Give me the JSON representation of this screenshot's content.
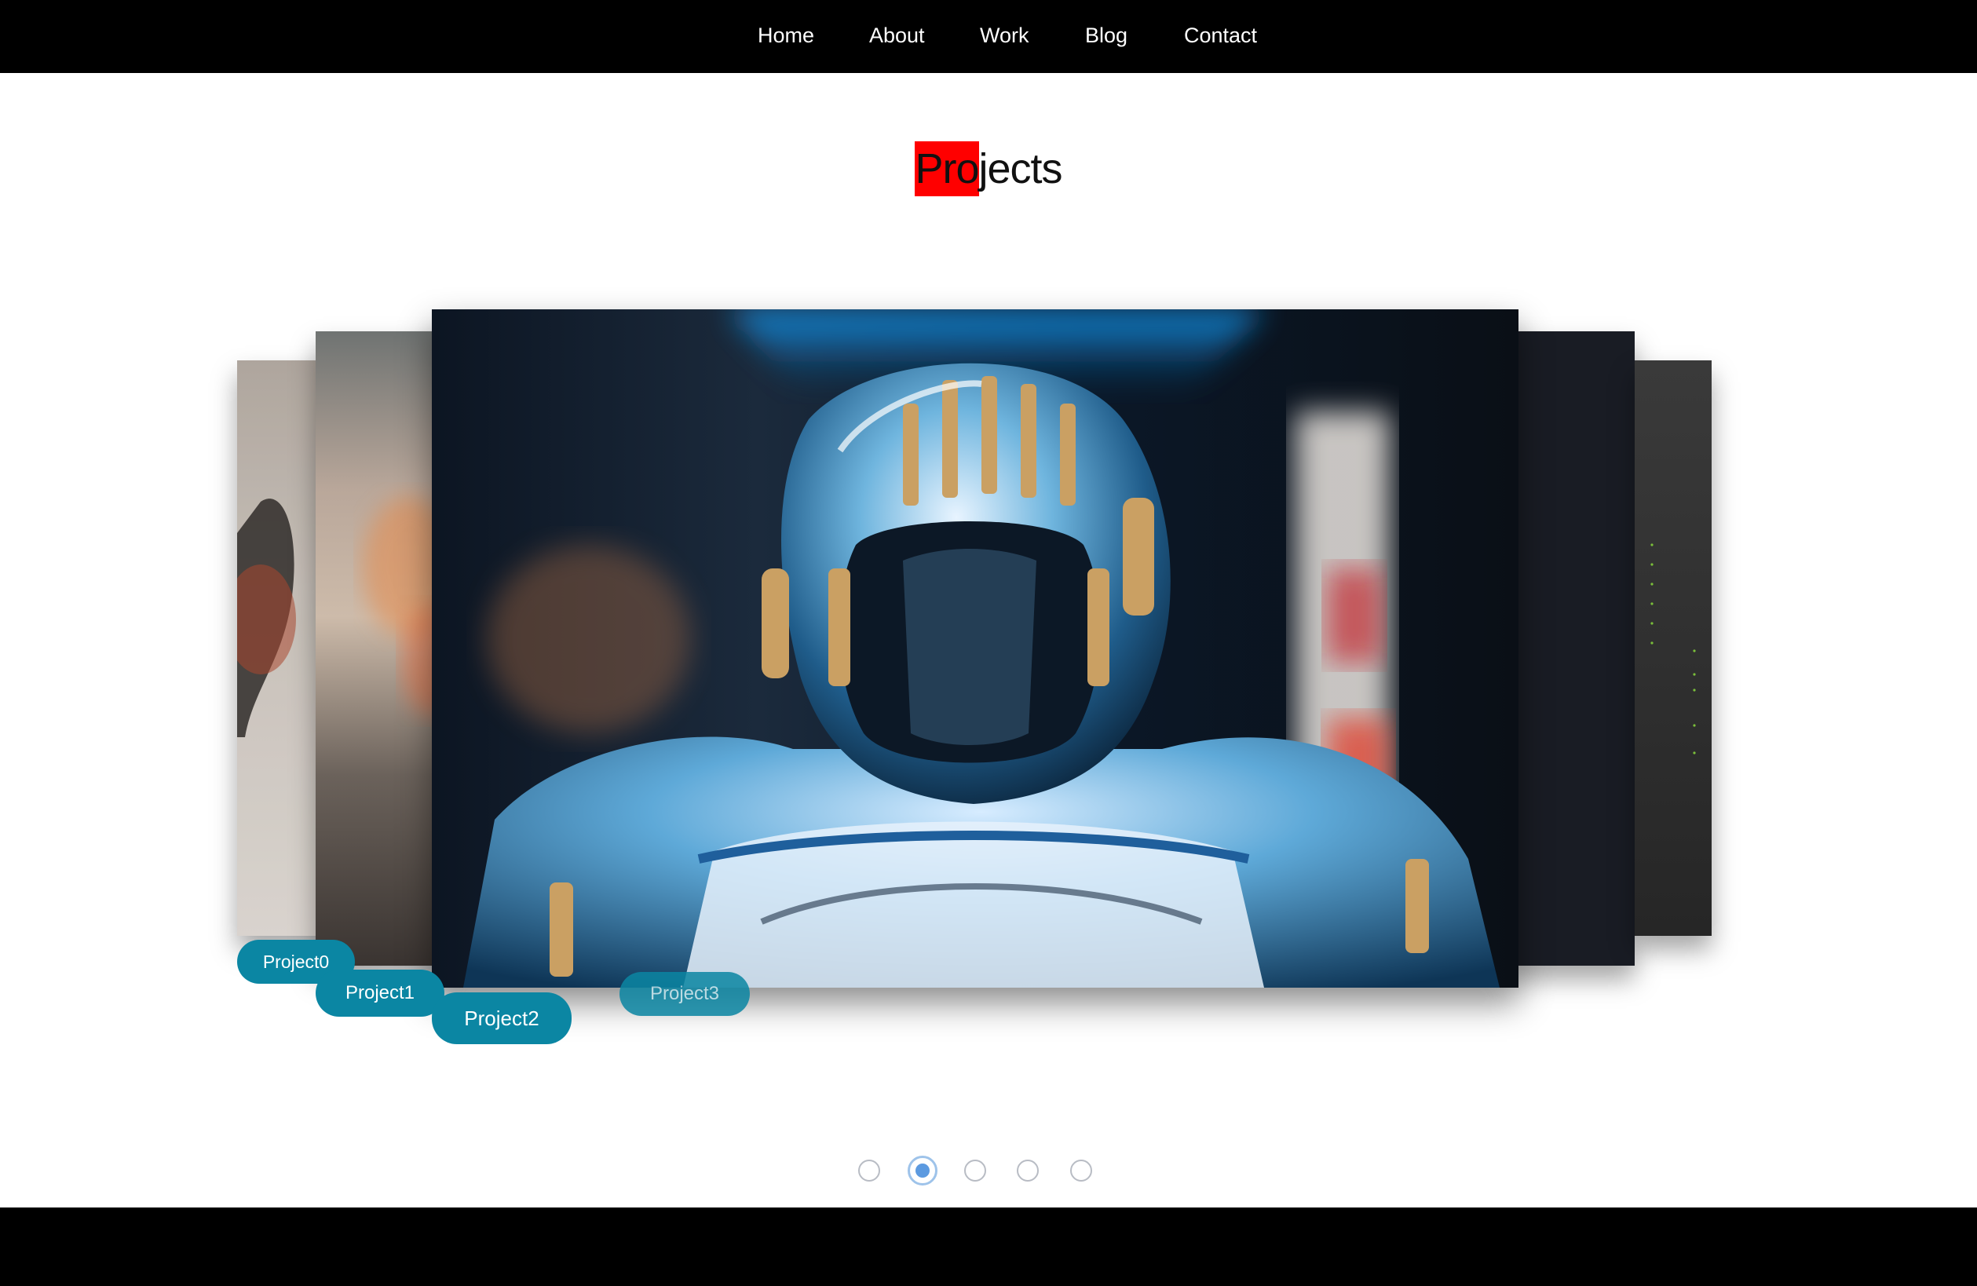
{
  "nav": {
    "items": [
      {
        "label": "Home"
      },
      {
        "label": "About"
      },
      {
        "label": "Work"
      },
      {
        "label": "Blog"
      },
      {
        "label": "Contact"
      }
    ]
  },
  "heading": {
    "highlighted": "Pro",
    "rest": "jects",
    "highlight_color": "#ff0000"
  },
  "slider": {
    "active_index": 1,
    "labels": {
      "far_left": "Project0",
      "left": "Project1",
      "center": "Project2",
      "right_behind": "Project3"
    },
    "accent_color": "#0b86a3"
  },
  "pagination": {
    "count": 5,
    "active": 2
  }
}
